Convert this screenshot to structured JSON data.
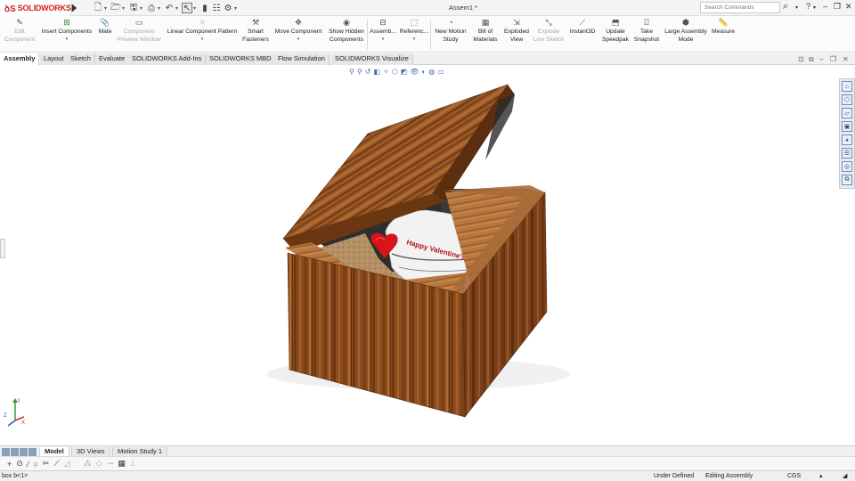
{
  "app": {
    "brand": "SOLIDWORKS",
    "window_title": "Assem1 *"
  },
  "search": {
    "placeholder": "Search Commands"
  },
  "commands": [
    {
      "label": "Edit Component",
      "disabled": true
    },
    {
      "label": "Insert Components",
      "disabled": false
    },
    {
      "label": "Mate",
      "disabled": false
    },
    {
      "label": "Component Preview Window",
      "disabled": true
    },
    {
      "label": "Linear Component Pattern",
      "disabled": false
    },
    {
      "label": "Smart Fasteners",
      "disabled": false
    },
    {
      "label": "Move Component",
      "disabled": false
    },
    {
      "label": "Show Hidden Components",
      "disabled": false
    },
    {
      "label": "Assemb...",
      "disabled": false
    },
    {
      "label": "Referenc...",
      "disabled": false
    },
    {
      "label": "New Motion Study",
      "disabled": false
    },
    {
      "label": "Bill of Materials",
      "disabled": false
    },
    {
      "label": "Exploded View",
      "disabled": false
    },
    {
      "label": "Explode Line Sketch",
      "disabled": true
    },
    {
      "label": "Instant3D",
      "disabled": false
    },
    {
      "label": "Update Speedpak",
      "disabled": false
    },
    {
      "label": "Take Snapshot",
      "disabled": false
    },
    {
      "label": "Large Assembly Mode",
      "disabled": false
    },
    {
      "label": "Measure",
      "disabled": false
    }
  ],
  "tabs": [
    "Assembly",
    "Layout",
    "Sketch",
    "Evaluate",
    "SOLIDWORKS Add-Ins",
    "SOLIDWORKS MBD",
    "Flow Simulation",
    "SOLIDWORKS Visualize"
  ],
  "active_tab": "Assembly",
  "model": {
    "mug_text": "Happy Valentine's"
  },
  "bottom_tabs": [
    "Model",
    "3D Views",
    "Motion Study 1"
  ],
  "active_bottom_tab": "Model",
  "status": {
    "left": "box b<1>",
    "definition": "Under Defined",
    "mode": "Editing Assembly",
    "units": "CGS"
  },
  "colors": {
    "brand_red": "#d02020",
    "wood": "#8a4a1c",
    "heart": "#d8141a",
    "triad_green": "#3a9a2a",
    "triad_blue": "#2a5ab0"
  }
}
